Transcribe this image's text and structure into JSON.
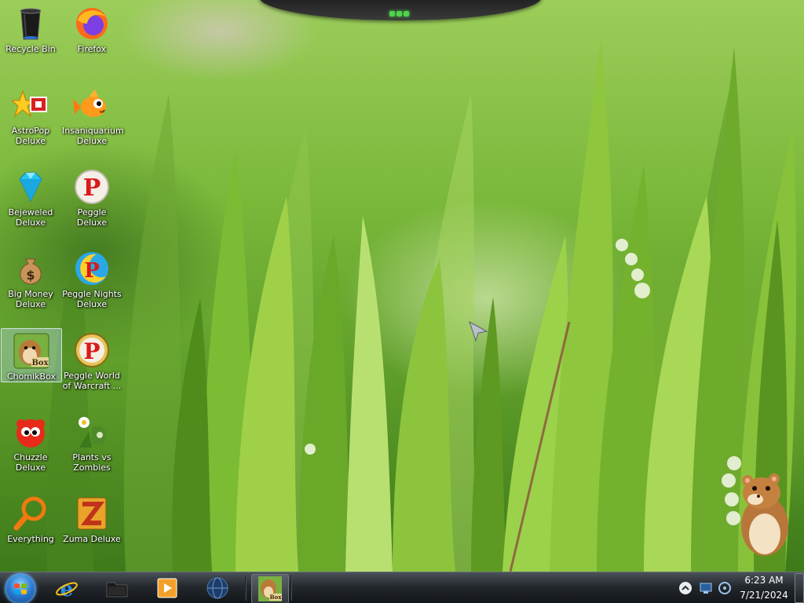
{
  "desktop": {
    "icons": [
      {
        "label": "Recycle Bin",
        "icon": "recycle-bin-icon"
      },
      {
        "label": "Firefox",
        "icon": "firefox-icon"
      },
      {
        "label": "AstroPop Deluxe",
        "icon": "astropop-icon"
      },
      {
        "label": "Insaniquarium Deluxe",
        "icon": "insaniquarium-icon"
      },
      {
        "label": "Bejeweled Deluxe",
        "icon": "bejeweled-icon"
      },
      {
        "label": "Peggle Deluxe",
        "icon": "peggle-icon"
      },
      {
        "label": "Big Money Deluxe",
        "icon": "big-money-icon"
      },
      {
        "label": "Peggle Nights Deluxe",
        "icon": "peggle-nights-icon"
      },
      {
        "label": "ChomikBox",
        "icon": "chomikbox-icon"
      },
      {
        "label": "Peggle World of Warcraft ...",
        "icon": "peggle-wow-icon"
      },
      {
        "label": "Chuzzle Deluxe",
        "icon": "chuzzle-icon"
      },
      {
        "label": "Plants vs Zombies",
        "icon": "plants-vs-zombies-icon"
      },
      {
        "label": "Everything",
        "icon": "everything-search-icon"
      },
      {
        "label": "Zuma Deluxe",
        "icon": "zuma-icon"
      }
    ],
    "selected_icon": "ChomikBox"
  },
  "taskbar": {
    "start_button": "windows-start-orb-icon",
    "quick_launch": [
      "internet-explorer-icon",
      "folder-icon",
      "media-player-icon",
      "network-globe-icon"
    ],
    "running_tasks": [
      "chomikbox-task-icon"
    ],
    "tray_icons": [
      "show-hidden-icons-chevron",
      "network-monitor-icon",
      "volume-icon"
    ],
    "clock": {
      "time": "6:23 AM",
      "date": "7/21/2024"
    }
  }
}
